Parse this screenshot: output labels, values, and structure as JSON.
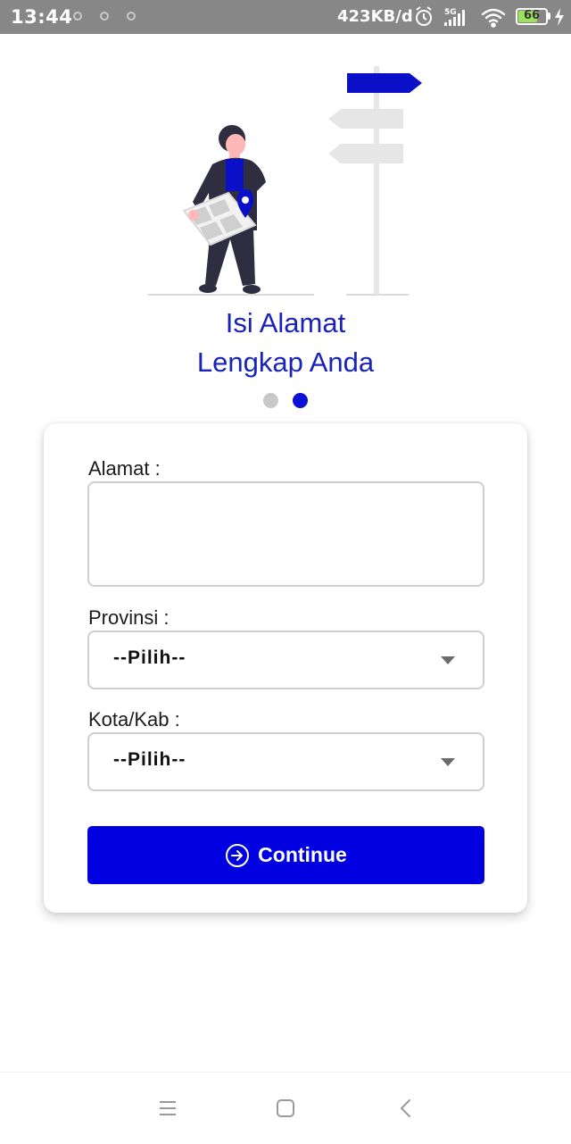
{
  "status_bar": {
    "time": "13:44",
    "network_speed": "423KB/d",
    "network_type": "5G",
    "battery_level": "66",
    "icons": [
      "alarm-icon",
      "signal-icon",
      "wifi-icon",
      "battery-icon",
      "charging-icon"
    ]
  },
  "onboarding": {
    "title_line1": "Isi Alamat",
    "title_line2": "Lengkap Anda",
    "page_count": 2,
    "active_page": 2
  },
  "form": {
    "address_label": "Alamat :",
    "address_value": "",
    "province_label": "Provinsi :",
    "province_selected": "--Pilih--",
    "city_label": "Kota/Kab :",
    "city_selected": "--Pilih--",
    "continue_label": "Continue"
  },
  "colors": {
    "accent": "#0000e0",
    "title": "#1a23b9",
    "status_bar": "#878787"
  },
  "nav_bar": {
    "icons": [
      "menu-icon",
      "home-icon",
      "back-icon"
    ]
  }
}
